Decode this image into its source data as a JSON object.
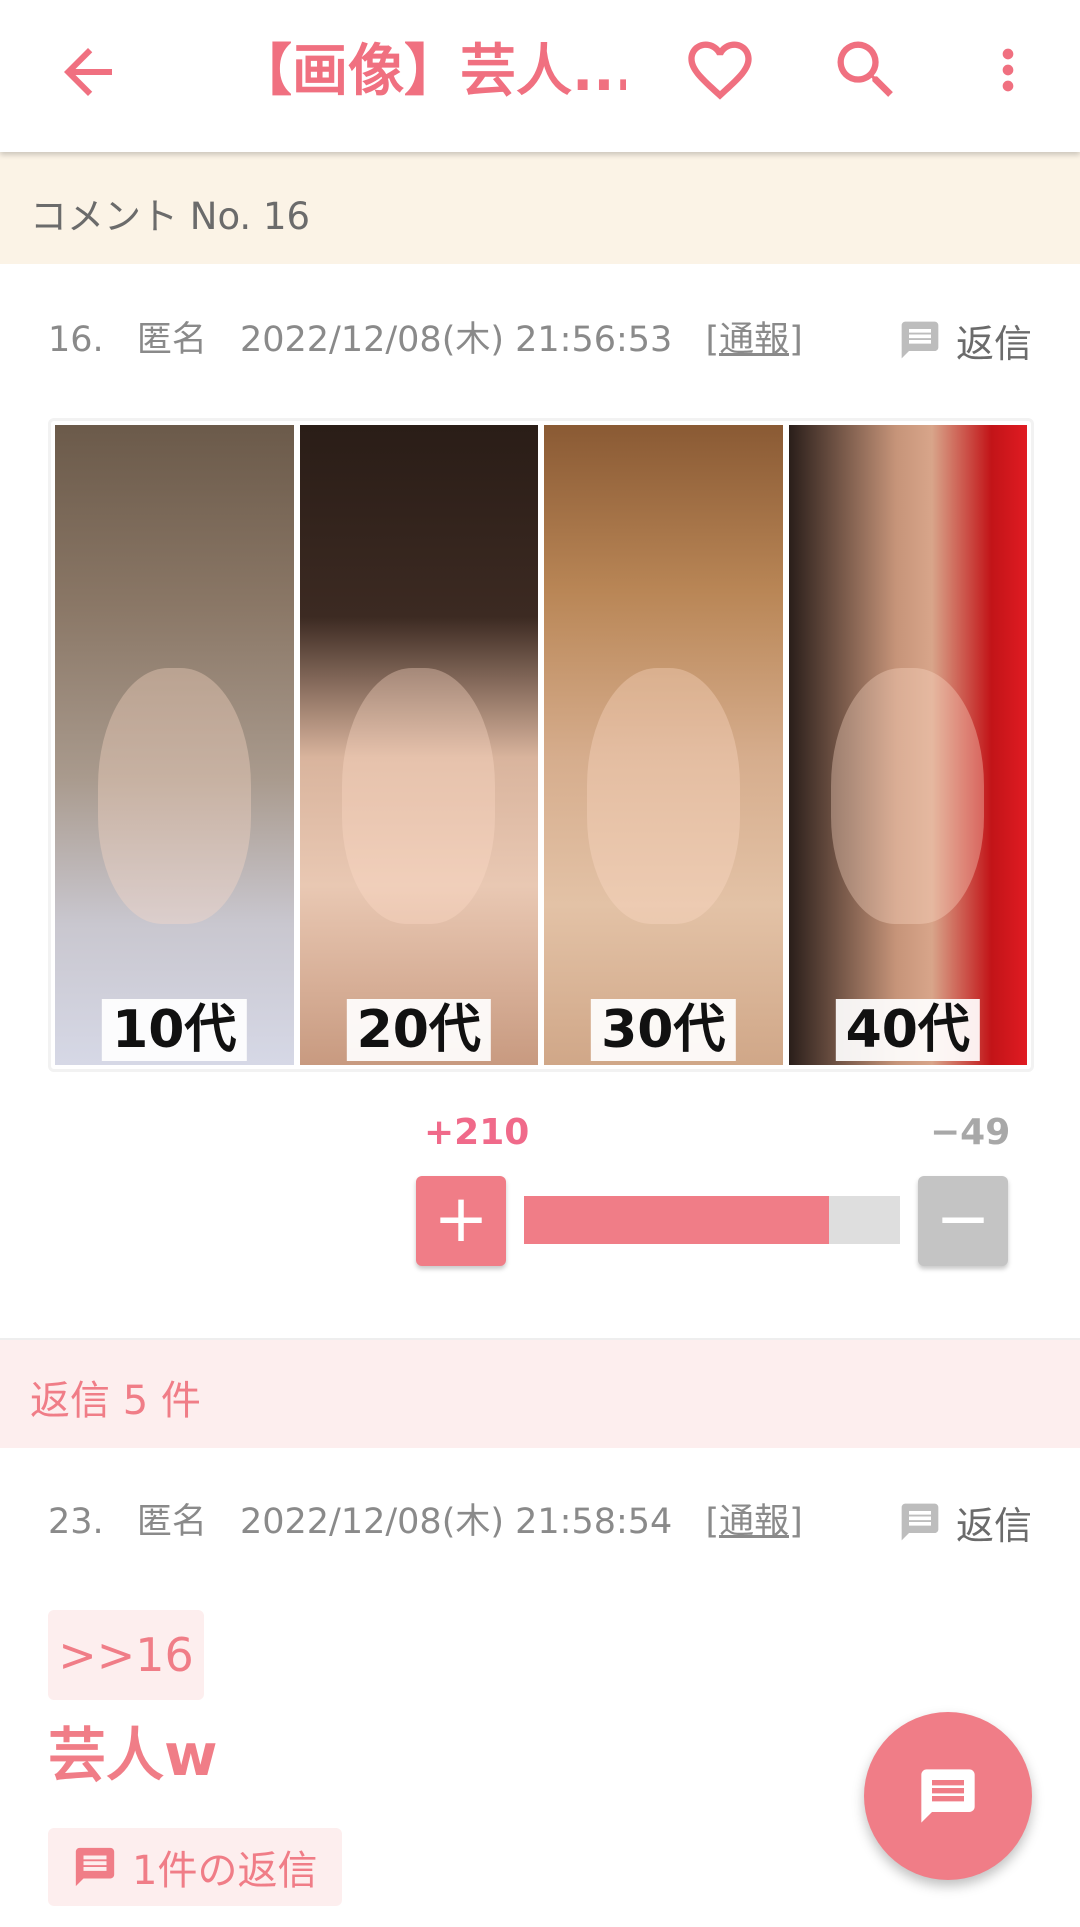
{
  "appbar": {
    "title": "【画像】芸人...",
    "icons": [
      "back-arrow-icon",
      "heart-icon",
      "search-icon",
      "more-vert-icon"
    ],
    "accent": "#f07080"
  },
  "comment_header": {
    "label": "コメント No. 16"
  },
  "comment": {
    "number": "16.",
    "author": "匿名",
    "timestamp": "2022/12/08(木) 21:56:53",
    "report": "[通報]",
    "reply_label": "返信",
    "image_captions": [
      "10代",
      "20代",
      "30代",
      "40代"
    ],
    "vote_plus_label": "+",
    "vote_minus_label": "−",
    "votes_plus": "+210",
    "votes_minus": "−49",
    "vote_ratio": 0.811
  },
  "replies_header": {
    "label": "返信 5 件"
  },
  "reply": {
    "number": "23.",
    "author": "匿名",
    "timestamp": "2022/12/08(木) 21:58:54",
    "report": "[通報]",
    "reply_label": "返信",
    "anchor": ">>16",
    "text": "芸人w",
    "nested_replies": "1件の返信"
  },
  "colors": {
    "pink": "#f07d87",
    "cream": "#fbf3e6",
    "pale_pink": "#fdeeee",
    "gray_text": "#8a8a8a"
  }
}
